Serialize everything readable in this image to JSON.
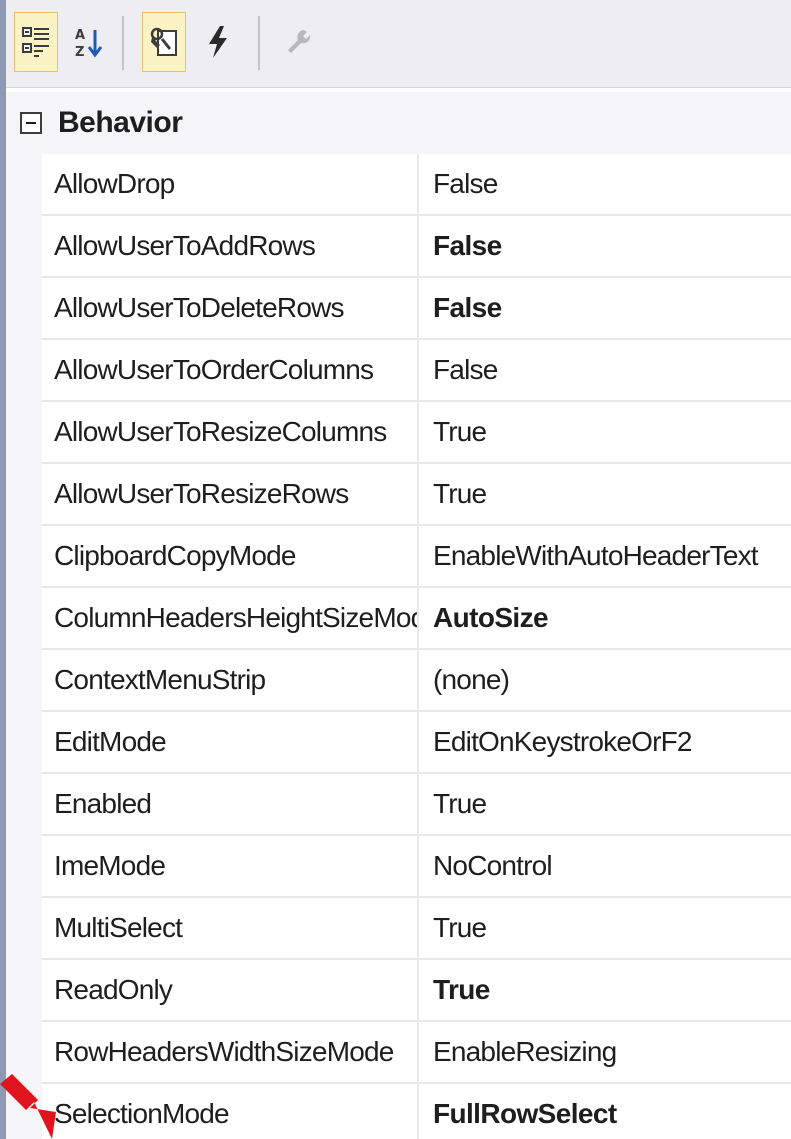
{
  "colors": {
    "accent_arrow": "#e0141e",
    "checked_button_bg": "#fcf3c4",
    "grid_line": "#e8e8ea"
  },
  "toolbar": {
    "buttons": [
      {
        "icon": "categorized-icon",
        "checked": true
      },
      {
        "icon": "alphabetical-sort-icon",
        "checked": false
      },
      {
        "icon": "properties-icon",
        "checked": true
      },
      {
        "icon": "events-lightning-icon",
        "checked": false
      },
      {
        "icon": "property-pages-wrench-icon",
        "checked": false,
        "disabled": true
      }
    ]
  },
  "category": {
    "label": "Behavior",
    "expanded": true
  },
  "rows": [
    {
      "name": "AllowDrop",
      "value": "False",
      "bold": false
    },
    {
      "name": "AllowUserToAddRows",
      "value": "False",
      "bold": true
    },
    {
      "name": "AllowUserToDeleteRows",
      "value": "False",
      "bold": true
    },
    {
      "name": "AllowUserToOrderColumns",
      "value": "False",
      "bold": false
    },
    {
      "name": "AllowUserToResizeColumns",
      "value": "True",
      "bold": false
    },
    {
      "name": "AllowUserToResizeRows",
      "value": "True",
      "bold": false
    },
    {
      "name": "ClipboardCopyMode",
      "value": "EnableWithAutoHeaderText",
      "bold": false
    },
    {
      "name": "ColumnHeadersHeightSizeMode",
      "value": "AutoSize",
      "bold": true
    },
    {
      "name": "ContextMenuStrip",
      "value": "(none)",
      "bold": false
    },
    {
      "name": "EditMode",
      "value": "EditOnKeystrokeOrF2",
      "bold": false
    },
    {
      "name": "Enabled",
      "value": "True",
      "bold": false
    },
    {
      "name": "ImeMode",
      "value": "NoControl",
      "bold": false
    },
    {
      "name": "MultiSelect",
      "value": "True",
      "bold": false
    },
    {
      "name": "ReadOnly",
      "value": "True",
      "bold": true
    },
    {
      "name": "RowHeadersWidthSizeMode",
      "value": "EnableResizing",
      "bold": false
    },
    {
      "name": "SelectionMode",
      "value": "FullRowSelect",
      "bold": true
    }
  ]
}
